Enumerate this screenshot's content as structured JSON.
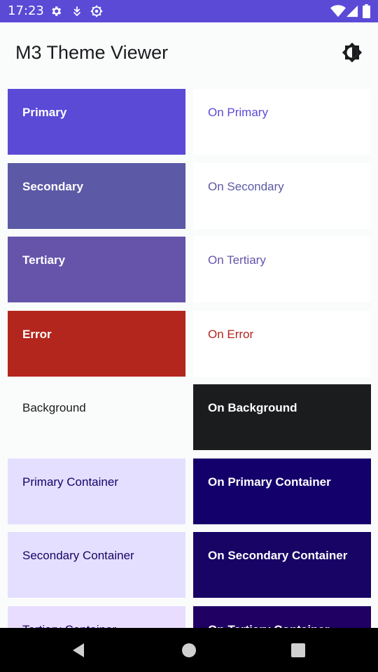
{
  "status_bar": {
    "time": "17:23",
    "left_icons": [
      "gear-icon",
      "download-icon",
      "settings-icon"
    ],
    "right_icons": [
      "wifi-icon",
      "signal-icon",
      "battery-icon"
    ],
    "color": "#5a4ad6"
  },
  "app_bar": {
    "title": "M3 Theme Viewer",
    "action_icon": "brightness-icon"
  },
  "swatches": [
    {
      "label": "Primary",
      "bg": "#5a4ad6",
      "fg": "#ffffff",
      "bold": true
    },
    {
      "label": "On Primary",
      "bg": "#ffffff",
      "fg": "#5a4ad6",
      "bold": false
    },
    {
      "label": "Secondary",
      "bg": "#5c59a6",
      "fg": "#ffffff",
      "bold": true
    },
    {
      "label": "On Secondary",
      "bg": "#ffffff",
      "fg": "#5c59a6",
      "bold": false
    },
    {
      "label": "Tertiary",
      "bg": "#6654aa",
      "fg": "#ffffff",
      "bold": true
    },
    {
      "label": "On Tertiary",
      "bg": "#ffffff",
      "fg": "#6654aa",
      "bold": false
    },
    {
      "label": "Error",
      "bg": "#b3261e",
      "fg": "#ffffff",
      "bold": true
    },
    {
      "label": "On Error",
      "bg": "#ffffff",
      "fg": "#b3261e",
      "bold": false
    },
    {
      "label": "Background",
      "bg": "#fafcfc",
      "fg": "#1a1c1e",
      "bold": false
    },
    {
      "label": "On Background",
      "bg": "#1a1c1e",
      "fg": "#ffffff",
      "bold": true
    },
    {
      "label": "Primary Container",
      "bg": "#e4dfff",
      "fg": "#14006b",
      "bold": false
    },
    {
      "label": "On Primary Container",
      "bg": "#14006b",
      "fg": "#ffffff",
      "bold": true
    },
    {
      "label": "Secondary Container",
      "bg": "#e4dfff",
      "fg": "#170465",
      "bold": false
    },
    {
      "label": "On Secondary Container",
      "bg": "#170465",
      "fg": "#ffffff",
      "bold": true
    },
    {
      "label": "Tertiary Container",
      "bg": "#e8ddff",
      "fg": "#200063",
      "bold": false
    },
    {
      "label": "On Tertiary Container",
      "bg": "#200063",
      "fg": "#ffffff",
      "bold": true
    }
  ],
  "nav_bar": {
    "buttons": [
      "back-icon",
      "home-icon",
      "recents-icon"
    ]
  }
}
